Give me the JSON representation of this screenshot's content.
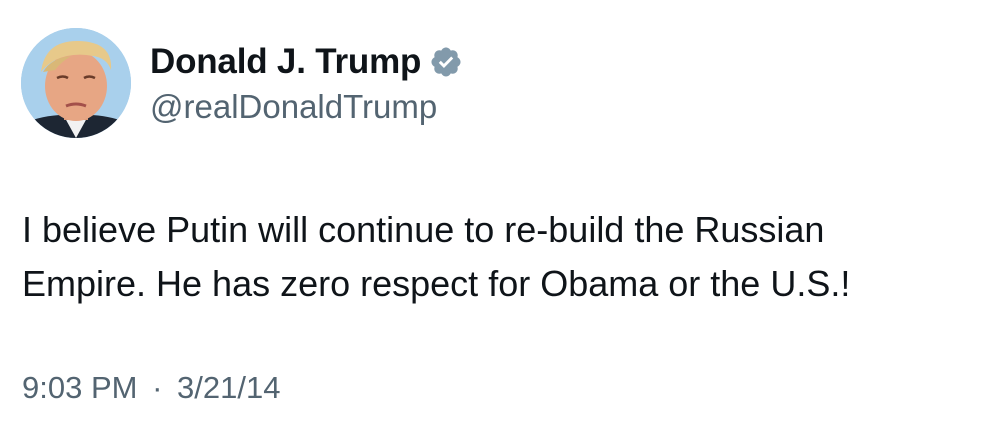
{
  "author": {
    "display_name": "Donald J. Trump",
    "handle": "@realDonaldTrump",
    "verified": true,
    "avatar_icon": "profile-photo",
    "verified_icon": "verified-badge-icon"
  },
  "tweet": {
    "lines": [
      "I believe Putin will continue to re-build the Russian",
      "Empire. He has zero respect for Obama or the U.S.!"
    ]
  },
  "meta": {
    "time": "9:03 PM",
    "separator": "·",
    "date": "3/21/14"
  },
  "colors": {
    "text": "#0f1419",
    "secondary": "#536471",
    "verified_badge": "#829aab"
  }
}
